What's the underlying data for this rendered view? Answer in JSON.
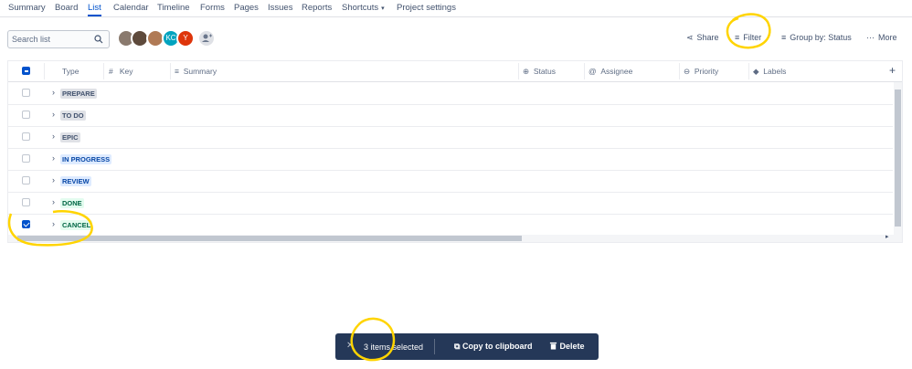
{
  "nav": {
    "items": [
      "Summary",
      "Board",
      "List",
      "Calendar",
      "Timeline",
      "Forms",
      "Pages",
      "Issues",
      "Reports",
      "Shortcuts",
      "Project settings"
    ],
    "active": "List"
  },
  "toolbar": {
    "search_placeholder": "Search list",
    "share_label": "Share",
    "filter_label": "Filter",
    "group_by_label": "Group by: Status",
    "more_label": "More"
  },
  "avatars": [
    {
      "initials": "",
      "color": "#8a7a6e"
    },
    {
      "initials": "",
      "color": "#5e4a3c"
    },
    {
      "initials": "",
      "color": "#b07a55"
    },
    {
      "initials": "KC",
      "color": "#00a3bf"
    },
    {
      "initials": "Y",
      "color": "#de350b"
    }
  ],
  "table": {
    "columns": [
      "Type",
      "Key",
      "Summary",
      "Status",
      "Assignee",
      "Priority",
      "Labels"
    ],
    "groups": [
      {
        "label": "PREPARE",
        "bg": "#dfe1e6",
        "fg": "#42526e",
        "checked": false
      },
      {
        "label": "TO DO",
        "bg": "#dfe1e6",
        "fg": "#42526e",
        "checked": false
      },
      {
        "label": "EPIC",
        "bg": "#dfe1e6",
        "fg": "#42526e",
        "checked": false
      },
      {
        "label": "IN PROGRESS",
        "bg": "#deebff",
        "fg": "#0747a6",
        "checked": false
      },
      {
        "label": "REVIEW",
        "bg": "#deebff",
        "fg": "#0747a6",
        "checked": false
      },
      {
        "label": "DONE",
        "bg": "#e3fcef",
        "fg": "#006644",
        "checked": false
      },
      {
        "label": "CANCEL",
        "bg": "#e3fcef",
        "fg": "#006644",
        "checked": true
      }
    ]
  },
  "action_bar": {
    "count_label": "3 items selected",
    "copy_label": "Copy to clipboard",
    "delete_label": "Delete"
  },
  "colors": {
    "accent": "#0052cc",
    "annotation": "#ffd400"
  }
}
